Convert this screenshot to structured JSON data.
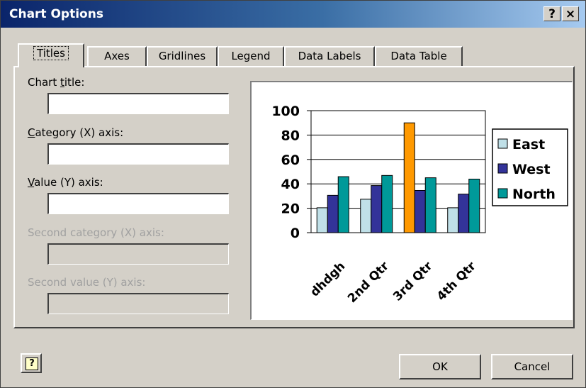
{
  "window": {
    "title": "Chart Options",
    "help_glyph": "?",
    "close_glyph": "×"
  },
  "tabs": [
    {
      "label": "Titles",
      "active": true
    },
    {
      "label": "Axes",
      "active": false
    },
    {
      "label": "Gridlines",
      "active": false
    },
    {
      "label": "Legend",
      "active": false
    },
    {
      "label": "Data Labels",
      "active": false
    },
    {
      "label": "Data Table",
      "active": false
    }
  ],
  "form": {
    "chart_title": {
      "label_pre": "Chart ",
      "label_u": "t",
      "label_post": "itle:",
      "value": ""
    },
    "category_x": {
      "label_pre": "",
      "label_u": "C",
      "label_post": "ategory (X) axis:",
      "value": ""
    },
    "value_y": {
      "label_pre": "",
      "label_u": "V",
      "label_post": "alue (Y) axis:",
      "value": ""
    },
    "second_category_x": {
      "label": "Second category (X) axis:",
      "value": "",
      "disabled": true
    },
    "second_value_y": {
      "label": "Second value (Y) axis:",
      "value": "",
      "disabled": true
    }
  },
  "buttons": {
    "ok": "OK",
    "cancel": "Cancel",
    "help_icon_glyph": "?"
  },
  "colors": {
    "east": "#c0e0e8",
    "west": "#333399",
    "north": "#009999",
    "selected": "#ff9900"
  },
  "chart_data": {
    "type": "bar",
    "categories": [
      "dhdgh",
      "2nd Qtr",
      "3rd Qtr",
      "4th Qtr"
    ],
    "series": [
      {
        "name": "East",
        "values": [
          20.4,
          27.4,
          90,
          20.4
        ]
      },
      {
        "name": "West",
        "values": [
          30.6,
          38.6,
          34.6,
          31.6
        ]
      },
      {
        "name": "North",
        "values": [
          45.9,
          46.9,
          45,
          43.9
        ]
      }
    ],
    "highlight": {
      "series": "East",
      "category": "3rd Qtr"
    },
    "ylim": [
      0,
      100
    ],
    "yticks": [
      "0",
      "20",
      "40",
      "60",
      "80",
      "100"
    ],
    "grid": true,
    "legend": "right"
  }
}
